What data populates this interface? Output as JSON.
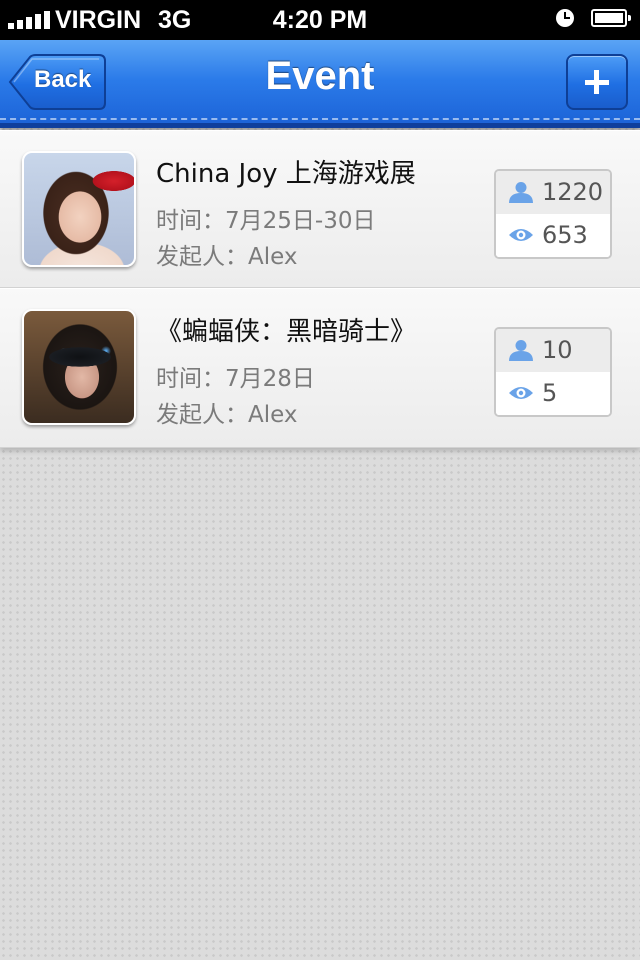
{
  "status_bar": {
    "carrier": "VIRGIN",
    "network": "3G",
    "time": "4:20 PM"
  },
  "nav": {
    "title": "Event",
    "back_label": "Back",
    "add_icon": "plus-icon",
    "accent_color": "#2b7be9"
  },
  "events": [
    {
      "title": "China Joy 上海游戏展",
      "time": "时间：7月25日-30日",
      "organizer": "发起人：Alex",
      "participants": "1220",
      "views": "653"
    },
    {
      "title": "《蝙蝠侠：黑暗骑士》",
      "time": "时间：7月28日",
      "organizer": "发起人：Alex",
      "participants": "10",
      "views": "5"
    }
  ]
}
